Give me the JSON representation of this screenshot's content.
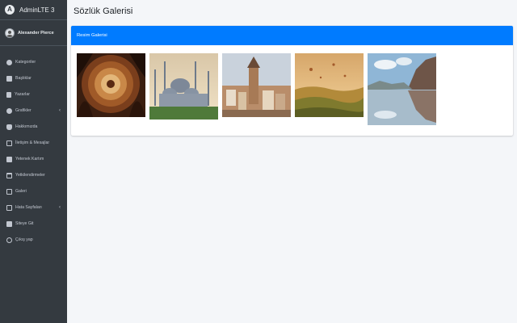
{
  "app": {
    "brand": "AdminLTE 3",
    "brand_logo_letter": "A"
  },
  "user": {
    "name": "Alexander Pierce"
  },
  "sidebar": {
    "items": [
      {
        "label": "Kategoriler",
        "icon": "tachometer-icon",
        "has_submenu": false
      },
      {
        "label": "Başlıklar",
        "icon": "table-icon",
        "has_submenu": false
      },
      {
        "label": "Yazarlar",
        "icon": "book-icon",
        "has_submenu": false
      },
      {
        "label": "Grafikler",
        "icon": "chart-icon",
        "has_submenu": true
      },
      {
        "label": "Hakkımızda",
        "icon": "hand-icon",
        "has_submenu": false
      },
      {
        "label": "İletişim & Mesajlar",
        "icon": "edit-icon",
        "has_submenu": false
      },
      {
        "label": "Yetenek Kartım",
        "icon": "id-card-icon",
        "has_submenu": false
      },
      {
        "label": "Yetkilendirmeler",
        "icon": "calendar-icon",
        "has_submenu": false
      },
      {
        "label": "Galeri",
        "icon": "image-icon",
        "has_submenu": false
      },
      {
        "label": "Hata Sayfaları",
        "icon": "envelope-icon",
        "has_submenu": true
      },
      {
        "label": "Siteye Git",
        "icon": "globe-icon",
        "has_submenu": false
      },
      {
        "label": "Çıkış yap",
        "icon": "power-icon",
        "has_submenu": false
      }
    ]
  },
  "main": {
    "title": "Sözlük Galerisi",
    "card": {
      "header": "Resim Galerisi",
      "images": [
        {
          "name": "hagia-sophia-dome-image"
        },
        {
          "name": "blue-mosque-image"
        },
        {
          "name": "galata-tower-image"
        },
        {
          "name": "cappadocia-balloons-image"
        },
        {
          "name": "coastal-cliffs-reflection-image"
        }
      ]
    }
  },
  "colors": {
    "sidebar_bg": "#343a40",
    "primary": "#007bff",
    "content_bg": "#f4f6f9"
  }
}
